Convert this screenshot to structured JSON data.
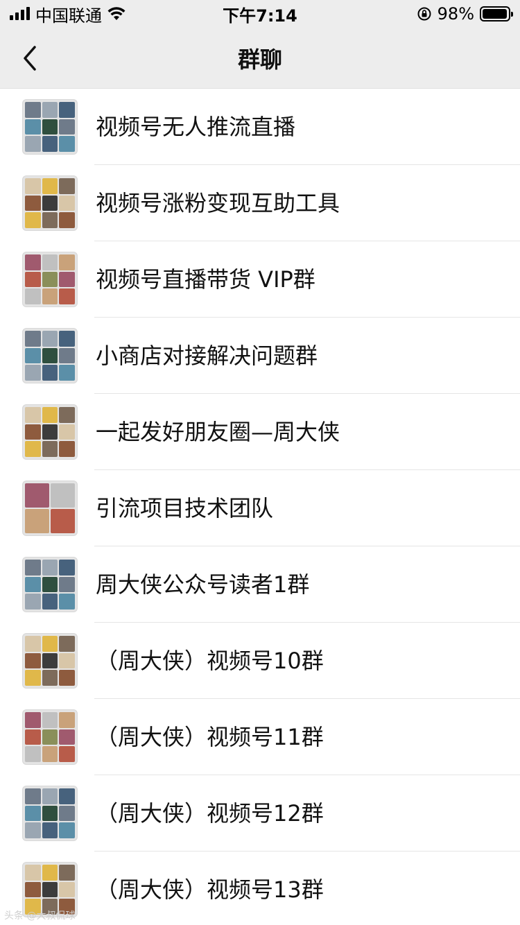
{
  "status_bar": {
    "carrier": "中国联通",
    "time": "下午7:14",
    "battery": "98%",
    "battery_level": 0.98,
    "icons": [
      "signal-icon",
      "wifi-icon",
      "orientation-lock-icon",
      "battery-icon"
    ]
  },
  "nav": {
    "title": "群聊",
    "back_icon": "chevron-left-icon"
  },
  "groups": [
    {
      "name": "视频号无人推流直播"
    },
    {
      "name": "视频号涨粉变现互助工具"
    },
    {
      "name": "视频号直播带货 VIP群"
    },
    {
      "name": "小商店对接解决问题群"
    },
    {
      "name": "一起发好朋友圈—周大侠"
    },
    {
      "name": "引流项目技术团队"
    },
    {
      "name": "周大侠公众号读者1群"
    },
    {
      "name": "（周大侠）视频号10群"
    },
    {
      "name": "（周大侠）视频号11群"
    },
    {
      "name": "（周大侠）视频号12群"
    },
    {
      "name": "（周大侠）视频号13群"
    }
  ],
  "watermark": "头条 @大叔侃球"
}
